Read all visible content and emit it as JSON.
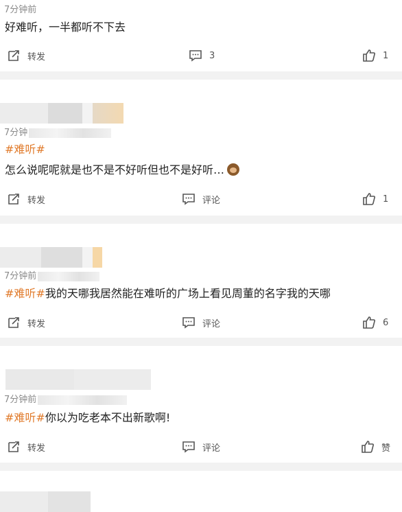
{
  "posts": [
    {
      "time": "7分钟前",
      "content": "好难听，一半都听不下去",
      "repost": "转发",
      "comment": "3",
      "like": "1"
    },
    {
      "time": "7分钟",
      "tag": "#难听#",
      "content": "怎么说呢呢就是也不是不好听但也不是好听…",
      "repost": "转发",
      "comment": "评论",
      "like": "1"
    },
    {
      "time": "7分钟前",
      "tag": "#难听#",
      "content": "我的天哪我居然能在难听的广场上看见周董的名字我的天哪",
      "repost": "转发",
      "comment": "评论",
      "like": "6"
    },
    {
      "time": "7分钟前",
      "tag": "#难听#",
      "content": "你以为吃老本不出新歌啊!",
      "repost": "转发",
      "comment": "评论",
      "like": "赞"
    }
  ],
  "icons": {
    "repost": "repost-icon",
    "comment": "comment-icon",
    "like": "thumbs-up-icon",
    "emoji": "see-no-evil-monkey-emoji"
  },
  "colors": {
    "tag": "#e07a2a",
    "separator": "#f2f2f2"
  }
}
